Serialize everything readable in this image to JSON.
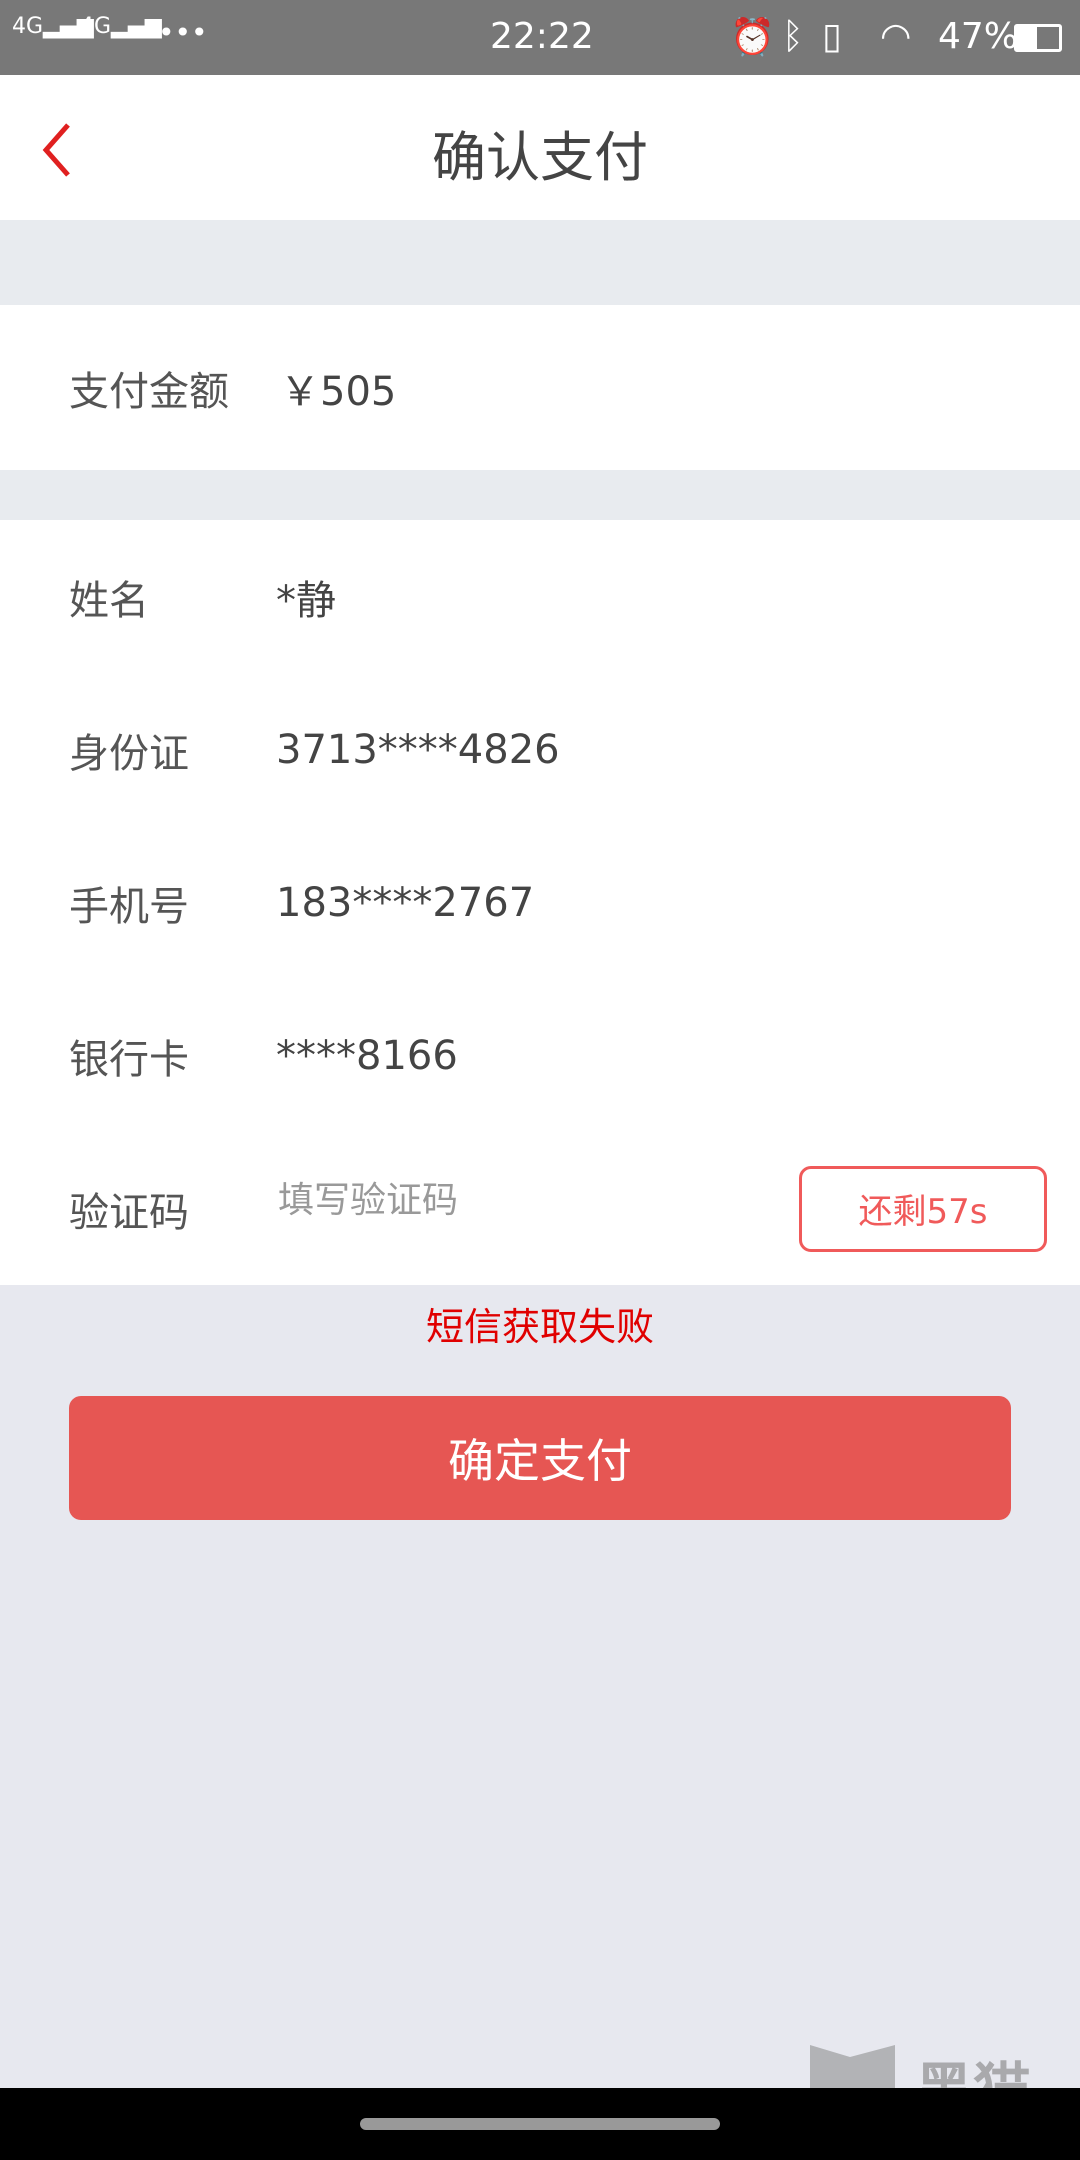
{
  "status_bar": {
    "signal1": "4G",
    "signal2": "4G",
    "more": "•••",
    "time": "22:22",
    "battery": "47%",
    "icons": [
      "alarm-icon",
      "bluetooth-icon",
      "vibrate-icon",
      "wifi-icon",
      "battery-icon"
    ]
  },
  "header": {
    "title": "确认支付",
    "back_icon": "chevron-left-icon"
  },
  "amount": {
    "label": "支付金额",
    "value": "￥505"
  },
  "info": [
    {
      "label": "姓名",
      "value": "*静"
    },
    {
      "label": "身份证",
      "value": "3713****4826"
    },
    {
      "label": "手机号",
      "value": "183****2767"
    },
    {
      "label": "银行卡",
      "value": "****8166"
    }
  ],
  "verify": {
    "label": "验证码",
    "placeholder": "填写验证码",
    "value": "",
    "countdown": "还剩57s"
  },
  "error_message": "短信获取失败",
  "confirm_button": "确定支付",
  "watermark": "黑猫 BLACK CAT",
  "colors": {
    "accent": "#e65653",
    "error": "#e00000",
    "countdown": "#f05a5a"
  }
}
